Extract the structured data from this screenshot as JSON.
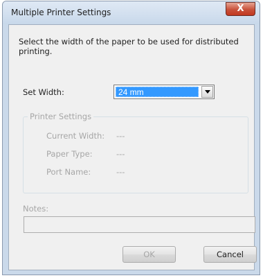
{
  "window": {
    "title": "Multiple Printer Settings",
    "close_glyph": "X"
  },
  "dialog": {
    "description": "Select the width of the paper to be used for distributed printing.",
    "set_width_label": "Set Width:",
    "set_width_value": "24 mm",
    "printer_settings": {
      "legend": "Printer Settings",
      "rows": [
        {
          "label": "Current Width:",
          "value": "---"
        },
        {
          "label": "Paper Type:",
          "value": "---"
        },
        {
          "label": "Port Name:",
          "value": "---"
        }
      ]
    },
    "notes_label": "Notes:",
    "notes_value": "",
    "ok_label": "OK",
    "cancel_label": "Cancel"
  },
  "colors": {
    "selection_highlight": "#3399ff",
    "disabled_text": "#a6a6a6",
    "title_bar": "#cad9ea",
    "close_button": "#c8513a"
  }
}
